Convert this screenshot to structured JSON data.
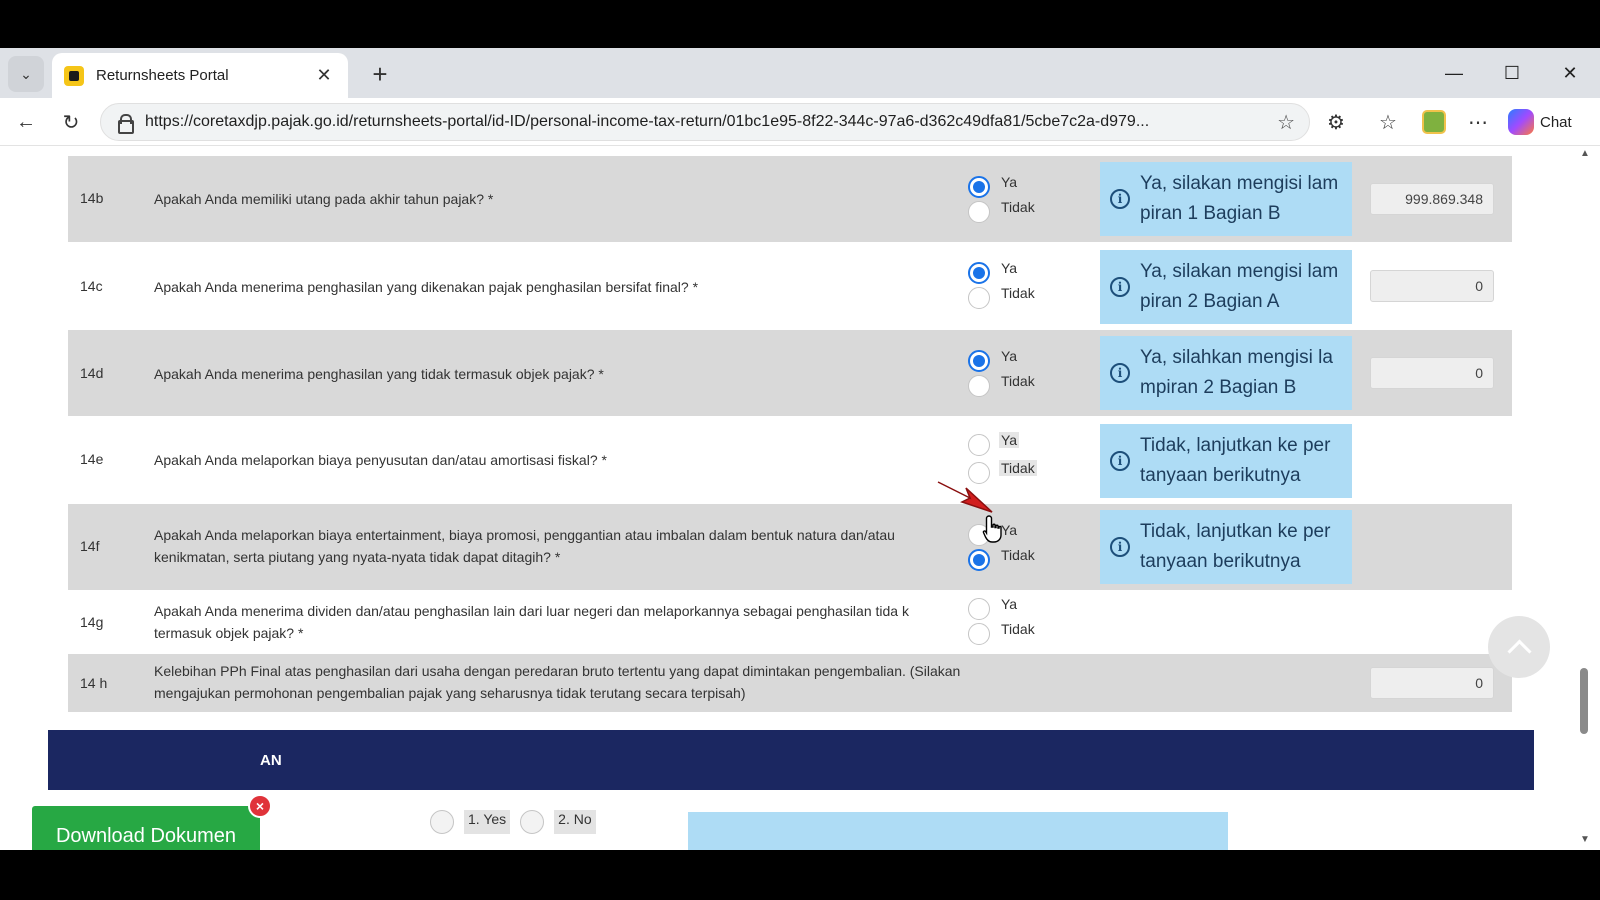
{
  "browser": {
    "tab_title": "Returnsheets Portal",
    "url": "https://coretaxdjp.pajak.go.id/returnsheets-portal/id-ID/personal-income-tax-return/01bc1e95-8f22-344c-97a6-d362c49dfa81/5cbe7c2a-d979...",
    "chat_label": "Chat"
  },
  "icons": {
    "tab_menu": "chevron-down-icon",
    "close": "close-icon",
    "new_tab": "plus-icon",
    "back": "back-arrow-icon",
    "reload": "reload-icon",
    "favorite": "star-icon",
    "extensions": "puzzle-icon",
    "favorites_list": "favorites-icon",
    "more": "more-icon",
    "info": "info-icon"
  },
  "form": {
    "rows": [
      {
        "no": "14b",
        "question": "Apakah Anda memiliki utang pada akhir tahun pajak? *",
        "yes": "Ya",
        "no_label": "Tidak",
        "selected": "yes",
        "info": "Ya, silakan mengisi lam piran 1 Bagian B",
        "amount": "999.869.348"
      },
      {
        "no": "14c",
        "question": "Apakah Anda menerima penghasilan yang dikenakan pajak penghasilan bersifat final? *",
        "yes": "Ya",
        "no_label": "Tidak",
        "selected": "yes",
        "info": "Ya, silakan mengisi lam piran 2 Bagian A",
        "amount": "0"
      },
      {
        "no": "14d",
        "question": "Apakah Anda menerima penghasilan yang tidak termasuk objek pajak? *",
        "yes": "Ya",
        "no_label": "Tidak",
        "selected": "yes",
        "info": "Ya, silahkan mengisi la mpiran 2 Bagian B",
        "amount": "0"
      },
      {
        "no": "14e",
        "question": "Apakah Anda melaporkan biaya penyusutan dan/atau amortisasi fiskal? *",
        "yes": "Ya",
        "no_label": "Tidak",
        "selected": "none",
        "info": "Tidak, lanjutkan ke per tanyaan berikutnya"
      },
      {
        "no": "14f",
        "question": "Apakah Anda melaporkan biaya entertainment, biaya promosi, penggantian atau imbalan dalam bentuk natura dan/atau kenikmatan, serta piutang yang nyata-nyata tidak dapat ditagih? *",
        "yes": "Ya",
        "no_label": "Tidak",
        "selected": "no",
        "info": "Tidak, lanjutkan ke per tanyaan berikutnya"
      },
      {
        "no": "14g",
        "question": "Apakah Anda menerima dividen dan/atau penghasilan lain dari luar negeri dan melaporkannya sebagai penghasilan tida k termasuk objek pajak? *",
        "yes": "Ya",
        "no_label": "Tidak",
        "selected": "none"
      },
      {
        "no": "14 h",
        "question": "Kelebihan PPh Final atas penghasilan dari usaha dengan peredaran bruto tertentu yang dapat dimintakan pengembalian. (Silakan mengajukan permohonan pengembalian pajak yang seharusnya tidak terutang secara terpisah)",
        "amount": "0"
      }
    ],
    "section_title": "AN",
    "next_yes": "1. Yes",
    "next_no": "2. No"
  },
  "download": {
    "label": "Download Dokumen",
    "close": "×"
  }
}
